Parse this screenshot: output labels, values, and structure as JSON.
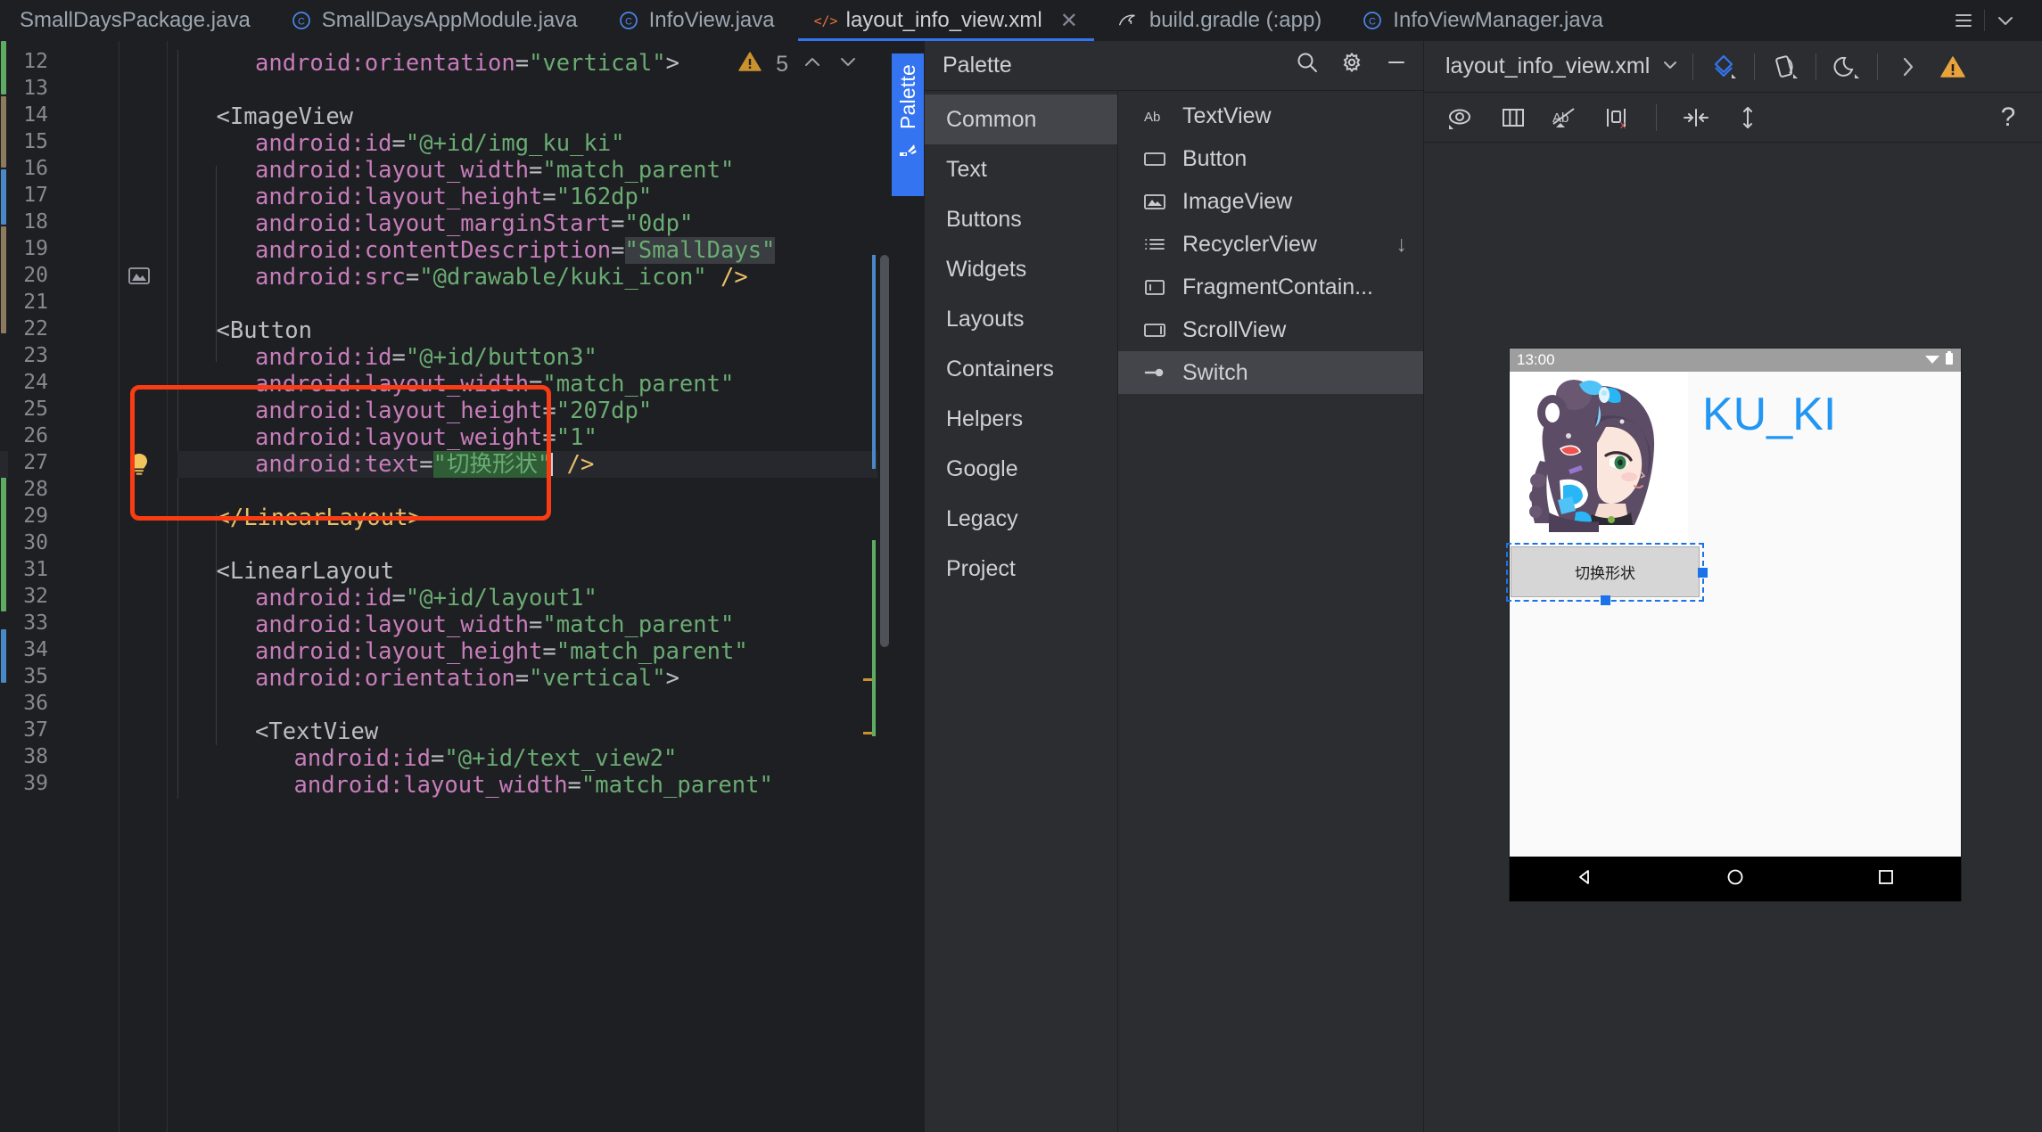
{
  "tabs": [
    {
      "label": "SmallDaysPackage.java",
      "icon": "java-class-icon",
      "active": false,
      "closable": false
    },
    {
      "label": "SmallDaysAppModule.java",
      "icon": "java-class-icon",
      "active": false,
      "closable": false
    },
    {
      "label": "InfoView.java",
      "icon": "java-class-icon",
      "active": false,
      "closable": false
    },
    {
      "label": "layout_info_view.xml",
      "icon": "xml-file-icon",
      "active": true,
      "closable": true
    },
    {
      "label": "build.gradle (:app)",
      "icon": "gradle-icon",
      "active": false,
      "closable": false
    },
    {
      "label": "InfoViewManager.java",
      "icon": "java-class-icon",
      "active": false,
      "closable": false
    }
  ],
  "tabbar_actions": {
    "list_icon": "hamburger-menu-icon",
    "chevron_icon": "chevron-down-icon"
  },
  "editor": {
    "inspections": {
      "warning_count": "5",
      "warning_icon": "warning-triangle-icon",
      "prev_icon": "chevron-up-icon",
      "next_icon": "chevron-down-icon"
    },
    "gutter_icons": {
      "image_preview": "image-preview-icon",
      "intention_bulb": "lightbulb-icon"
    },
    "current_line": 27,
    "lines": [
      {
        "n": 12,
        "indent": 2,
        "text": "android:orientation=\"vertical\">"
      },
      {
        "n": 13,
        "indent": 0,
        "text": ""
      },
      {
        "n": 14,
        "indent": 1,
        "text": "<ImageView"
      },
      {
        "n": 15,
        "indent": 2,
        "text": "android:id=\"@+id/img_ku_ki\""
      },
      {
        "n": 16,
        "indent": 2,
        "text": "android:layout_width=\"match_parent\""
      },
      {
        "n": 17,
        "indent": 2,
        "text": "android:layout_height=\"162dp\""
      },
      {
        "n": 18,
        "indent": 2,
        "text": "android:layout_marginStart=\"0dp\""
      },
      {
        "n": 19,
        "indent": 2,
        "text": "android:contentDescription=\"SmallDays\""
      },
      {
        "n": 20,
        "indent": 2,
        "text": "android:src=\"@drawable/kuki_icon\" />"
      },
      {
        "n": 21,
        "indent": 0,
        "text": ""
      },
      {
        "n": 22,
        "indent": 1,
        "text": "<Button"
      },
      {
        "n": 23,
        "indent": 2,
        "text": "android:id=\"@+id/button3\""
      },
      {
        "n": 24,
        "indent": 2,
        "text": "android:layout_width=\"match_parent\""
      },
      {
        "n": 25,
        "indent": 2,
        "text": "android:layout_height=\"207dp\""
      },
      {
        "n": 26,
        "indent": 2,
        "text": "android:layout_weight=\"1\""
      },
      {
        "n": 27,
        "indent": 2,
        "text": "android:text=\"切换形状\" />"
      },
      {
        "n": 28,
        "indent": 0,
        "text": ""
      },
      {
        "n": 29,
        "indent": 1,
        "text": "</LinearLayout>"
      },
      {
        "n": 30,
        "indent": 0,
        "text": ""
      },
      {
        "n": 31,
        "indent": 1,
        "text": "<LinearLayout"
      },
      {
        "n": 32,
        "indent": 2,
        "text": "android:id=\"@+id/layout1\""
      },
      {
        "n": 33,
        "indent": 2,
        "text": "android:layout_width=\"match_parent\""
      },
      {
        "n": 34,
        "indent": 2,
        "text": "android:layout_height=\"match_parent\""
      },
      {
        "n": 35,
        "indent": 2,
        "text": "android:orientation=\"vertical\">"
      },
      {
        "n": 36,
        "indent": 0,
        "text": ""
      },
      {
        "n": 37,
        "indent": 2,
        "text": "<TextView"
      },
      {
        "n": 38,
        "indent": 3,
        "text": "android:id=\"@+id/text_view2\""
      },
      {
        "n": 39,
        "indent": 3,
        "text": "android:layout_width=\"match_parent\""
      }
    ],
    "annotation": {
      "color": "#FA3C14",
      "shape": "rounded-rectangle",
      "covers_lines": "22-27"
    }
  },
  "side_tab": {
    "label": "Palette",
    "icon": "palette-icon",
    "color": "#3574F0"
  },
  "palette": {
    "title": "Palette",
    "search_icon": "search-icon",
    "settings_icon": "gear-icon",
    "minimize_icon": "minimize-icon",
    "categories": [
      {
        "label": "Common",
        "selected": true
      },
      {
        "label": "Text",
        "selected": false
      },
      {
        "label": "Buttons",
        "selected": false
      },
      {
        "label": "Widgets",
        "selected": false
      },
      {
        "label": "Layouts",
        "selected": false
      },
      {
        "label": "Containers",
        "selected": false
      },
      {
        "label": "Helpers",
        "selected": false
      },
      {
        "label": "Google",
        "selected": false
      },
      {
        "label": "Legacy",
        "selected": false
      },
      {
        "label": "Project",
        "selected": false
      }
    ],
    "components": [
      {
        "label": "TextView",
        "icon": "textview-icon",
        "selected": false,
        "trailing": ""
      },
      {
        "label": "Button",
        "icon": "button-icon",
        "selected": false,
        "trailing": ""
      },
      {
        "label": "ImageView",
        "icon": "imageview-icon",
        "selected": false,
        "trailing": ""
      },
      {
        "label": "RecyclerView",
        "icon": "recyclerview-icon",
        "selected": false,
        "trailing": "↓"
      },
      {
        "label": "FragmentContain...",
        "icon": "fragment-container-icon",
        "selected": false,
        "trailing": ""
      },
      {
        "label": "ScrollView",
        "icon": "scrollview-icon",
        "selected": false,
        "trailing": ""
      },
      {
        "label": "Switch",
        "icon": "switch-icon",
        "selected": true,
        "trailing": ""
      }
    ]
  },
  "design": {
    "file_name": "layout_info_view.xml",
    "file_dropdown_icon": "chevron-down-icon",
    "toolbar_row1": [
      {
        "name": "design-mode-icon",
        "label": ""
      },
      {
        "name": "orientation-icon",
        "label": ""
      },
      {
        "name": "night-mode-icon",
        "label": ""
      },
      {
        "name": "expand-right-icon",
        "label": ""
      },
      {
        "name": "warning-triangle-icon",
        "label": ""
      }
    ],
    "toolbar_row2": [
      {
        "name": "eye-visibility-icon",
        "label": ""
      },
      {
        "name": "columns-layout-icon",
        "label": ""
      },
      {
        "name": "hide-text-icon",
        "label": ""
      },
      {
        "name": "constraints-off-icon",
        "label": ""
      },
      {
        "name": "pack-horizontal-icon",
        "label": ""
      },
      {
        "name": "expand-vertical-icon",
        "label": ""
      },
      {
        "name": "help-icon",
        "label": "?"
      }
    ],
    "help_label": "?",
    "preview": {
      "status_time": "13:00",
      "wifi_icon": "wifi-icon",
      "battery_icon": "battery-icon",
      "title_text": "KU_KI",
      "title_color": "#2196F3",
      "button_text": "切换形状",
      "nav_back_icon": "nav-back-triangle-icon",
      "nav_home_icon": "nav-home-circle-icon",
      "nav_recents_icon": "nav-recents-square-icon"
    }
  }
}
